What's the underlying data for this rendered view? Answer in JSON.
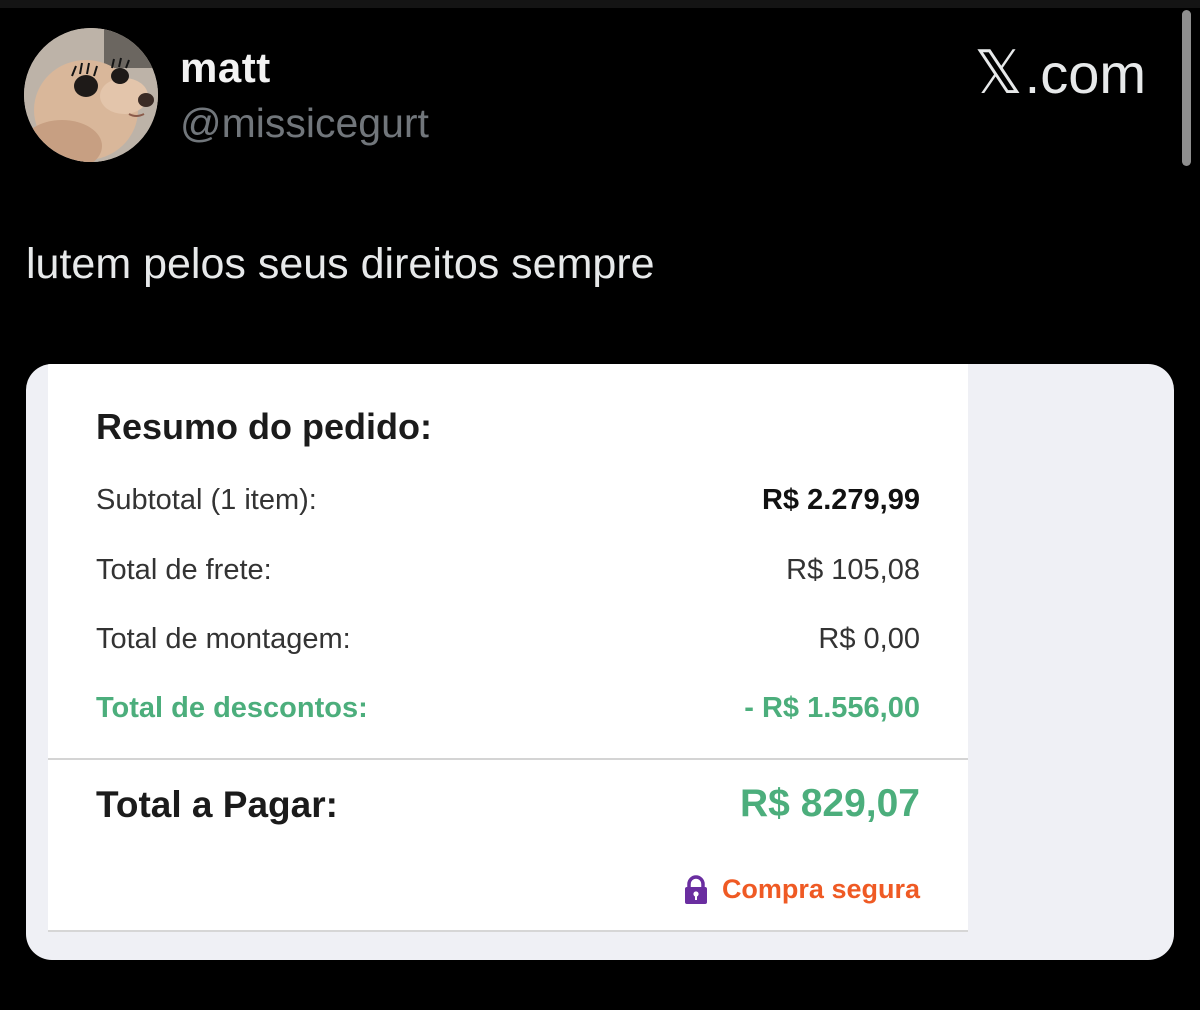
{
  "author": {
    "display_name": "matt",
    "handle": "@missicegurt"
  },
  "brand": {
    "mark": "𝕏",
    "text": ".com"
  },
  "tweet": {
    "text": "lutem pelos seus direitos sempre"
  },
  "order_summary": {
    "title": "Resumo do pedido:",
    "rows": [
      {
        "label": "Subtotal (1 item):",
        "value": "R$ 2.279,99"
      },
      {
        "label": "Total de frete:",
        "value": "R$ 105,08"
      },
      {
        "label": "Total de montagem:",
        "value": "R$ 0,00"
      },
      {
        "label": "Total de descontos:",
        "value": "- R$ 1.556,00"
      }
    ],
    "total_label": "Total a Pagar:",
    "total_value": "R$ 829,07",
    "secure_label": "Compra segura"
  },
  "colors": {
    "discount_green": "#4cae7c",
    "secure_orange": "#ef5a24",
    "lock_purple": "#6a2ea0"
  },
  "icons": {
    "avatar": "dog-avatar",
    "lock": "lock-icon"
  }
}
